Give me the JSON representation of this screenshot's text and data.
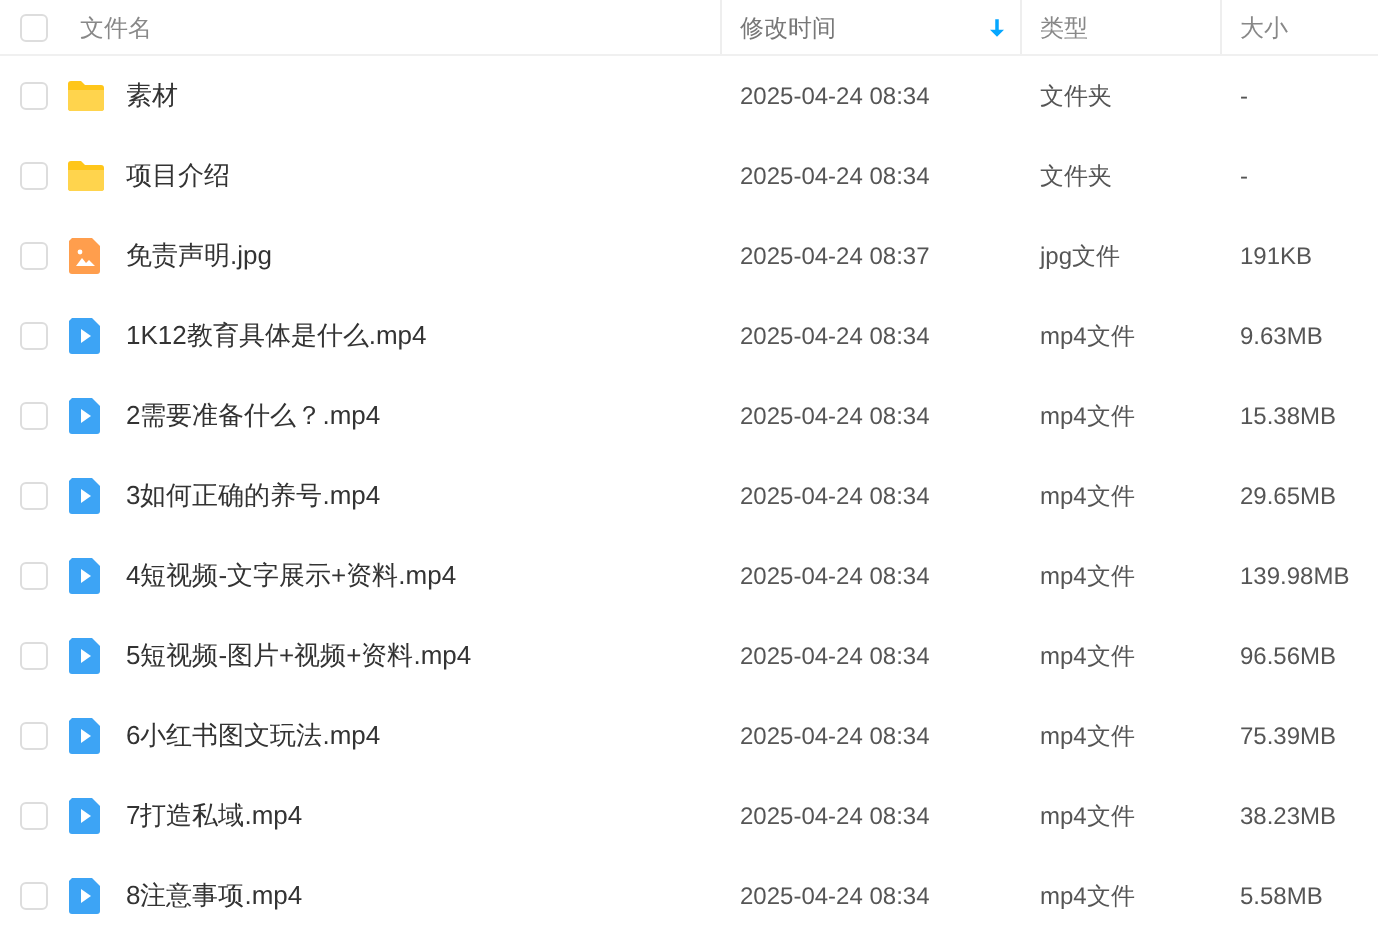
{
  "header": {
    "checked": false,
    "columns": [
      {
        "label": "文件名",
        "sorted": false
      },
      {
        "label": "修改时间",
        "sorted": true
      },
      {
        "label": "类型",
        "sorted": false
      },
      {
        "label": "大小",
        "sorted": false
      }
    ]
  },
  "rows": [
    {
      "kind": "folder",
      "name": "素材",
      "modified": "2025-04-24 08:34",
      "type": "文件夹",
      "size": "-",
      "checked": false
    },
    {
      "kind": "folder",
      "name": "项目介绍",
      "modified": "2025-04-24 08:34",
      "type": "文件夹",
      "size": "-",
      "checked": false
    },
    {
      "kind": "image",
      "name": "免责声明.jpg",
      "modified": "2025-04-24 08:37",
      "type": "jpg文件",
      "size": "191KB",
      "checked": false
    },
    {
      "kind": "video",
      "name": "1K12教育具体是什么.mp4",
      "modified": "2025-04-24 08:34",
      "type": "mp4文件",
      "size": "9.63MB",
      "checked": false
    },
    {
      "kind": "video",
      "name": "2需要准备什么？.mp4",
      "modified": "2025-04-24 08:34",
      "type": "mp4文件",
      "size": "15.38MB",
      "checked": false
    },
    {
      "kind": "video",
      "name": "3如何正确的养号.mp4",
      "modified": "2025-04-24 08:34",
      "type": "mp4文件",
      "size": "29.65MB",
      "checked": false
    },
    {
      "kind": "video",
      "name": "4短视频-文字展示+资料.mp4",
      "modified": "2025-04-24 08:34",
      "type": "mp4文件",
      "size": "139.98MB",
      "checked": false
    },
    {
      "kind": "video",
      "name": "5短视频-图片+视频+资料.mp4",
      "modified": "2025-04-24 08:34",
      "type": "mp4文件",
      "size": "96.56MB",
      "checked": false
    },
    {
      "kind": "video",
      "name": "6小红书图文玩法.mp4",
      "modified": "2025-04-24 08:34",
      "type": "mp4文件",
      "size": "75.39MB",
      "checked": false
    },
    {
      "kind": "video",
      "name": "7打造私域.mp4",
      "modified": "2025-04-24 08:34",
      "type": "mp4文件",
      "size": "38.23MB",
      "checked": false
    },
    {
      "kind": "video",
      "name": "8注意事项.mp4",
      "modified": "2025-04-24 08:34",
      "type": "mp4文件",
      "size": "5.58MB",
      "checked": false
    }
  ]
}
